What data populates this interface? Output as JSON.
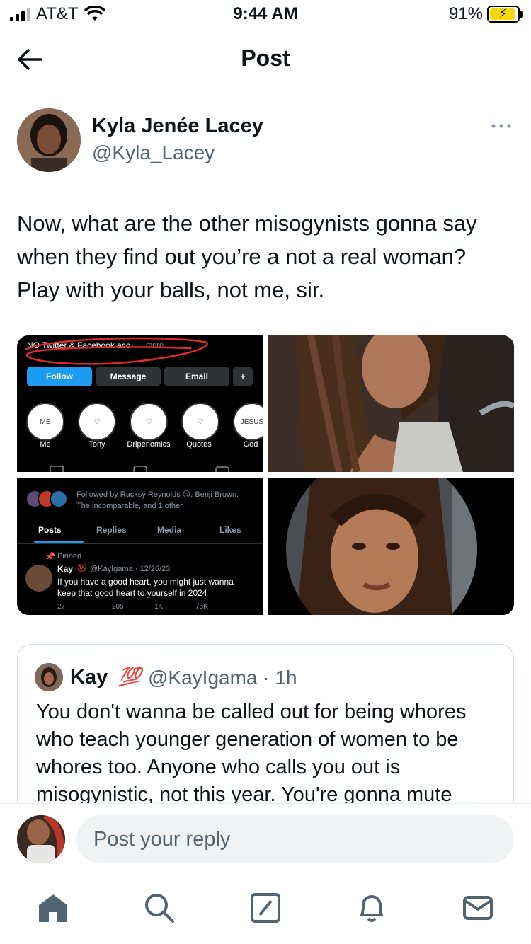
{
  "status": {
    "carrier": "AT&T",
    "time": "9:44 AM",
    "battery": "91%",
    "battery_level": 0.91
  },
  "header": {
    "title": "Post",
    "back_icon": "arrow-left-icon"
  },
  "post": {
    "author_name": "Kyla Jenée Lacey",
    "author_handle": "@Kyla_Lacey",
    "text": "Now, what are the other misogynists gonna say when they find out you’re a not a real woman?  Play with your balls, not me, sir."
  },
  "media": {
    "screenshot1": {
      "bio_line": "NO Twitter & Facebook acc",
      "more": "more",
      "follow": "Follow",
      "message": "Message",
      "email": "Email",
      "add_user": "+",
      "highlights": [
        {
          "label": "Me",
          "thumb": "ME"
        },
        {
          "label": "Tony",
          "thumb": "♡"
        },
        {
          "label": "Dripenomics",
          "thumb": "♡"
        },
        {
          "label": "Quotes",
          "thumb": "♡"
        },
        {
          "label": "God",
          "thumb": "JESUS"
        }
      ]
    },
    "screenshot2": {
      "followed_by": "Followed by Racksy Reynolds 😏, Benji Brown,",
      "followed_by2": "The incomparable, and 1 other",
      "tabs": [
        "Posts",
        "Replies",
        "Media",
        "Likes"
      ],
      "pinned": "Pinned",
      "name": "Kay",
      "emoji": "💯",
      "handle_date": "@KayIgama · 12/26/23",
      "text1": "If you have a good heart, you might just wanna",
      "text2": "keep that good heart to yourself in 2024",
      "stats": [
        "27",
        "205",
        "1K",
        "75K"
      ]
    }
  },
  "quote": {
    "name": "Kay",
    "emoji": "💯",
    "handle": "@KayIgama · 1h",
    "text": "You don't wanna be called out for being whores who teach younger generation of women to be whores too. Anyone who calls you out is misogynistic, not this year. You're gonna mute"
  },
  "reply": {
    "placeholder": "Post your reply"
  },
  "tabbar": [
    "home-icon",
    "search-icon",
    "grok-icon",
    "notifications-icon",
    "messages-icon"
  ]
}
